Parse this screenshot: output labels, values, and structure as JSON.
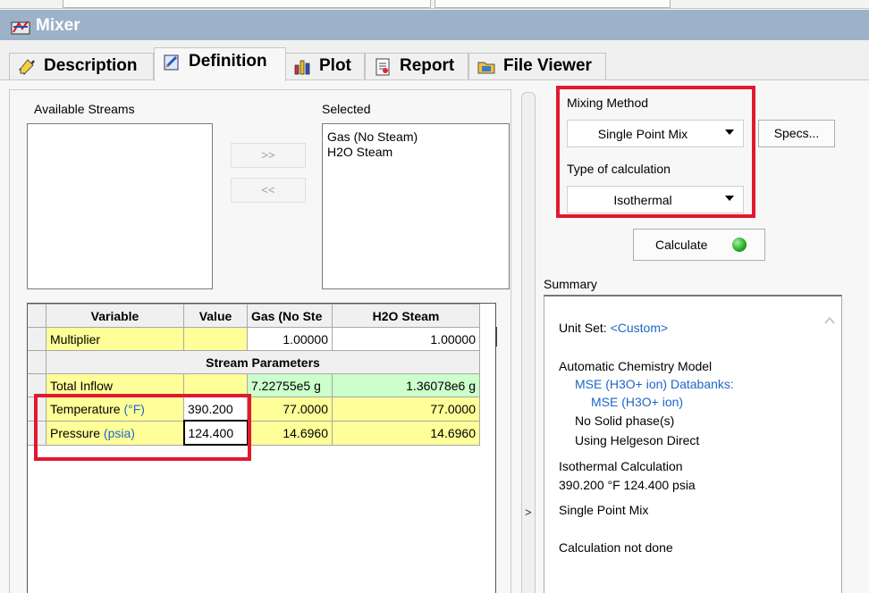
{
  "window": {
    "title": "Mixer"
  },
  "tabs": [
    {
      "label": "Description",
      "icon": "pencil-check-icon",
      "active": false
    },
    {
      "label": "Definition",
      "icon": "definition-edit-icon",
      "active": true
    },
    {
      "label": "Plot",
      "icon": "bar-chart-icon",
      "active": false
    },
    {
      "label": "Report",
      "icon": "report-icon",
      "active": false
    },
    {
      "label": "File Viewer",
      "icon": "file-viewer-icon",
      "active": false
    }
  ],
  "streams": {
    "available_label": "Available Streams",
    "selected_label": "Selected",
    "available_items": [],
    "selected_items": [
      "Gas (No Steam)",
      "H2O Steam"
    ],
    "add_button": ">>",
    "remove_button": "<<"
  },
  "grid": {
    "headers": [
      "Variable",
      "Value",
      "Gas (No Ste",
      "H2O Steam"
    ],
    "multiplier": {
      "label": "Multiplier",
      "value": "",
      "gas": "1.00000",
      "steam": "1.00000"
    },
    "section_label": "Stream Parameters",
    "total_inflow": {
      "label": "Total Inflow",
      "value": "",
      "gas": "7.22755e5 g",
      "steam": "1.36078e6 g"
    },
    "temperature": {
      "label": "Temperature",
      "unit": "(°F)",
      "value": "390.200",
      "gas": "77.0000",
      "steam": "77.0000"
    },
    "pressure": {
      "label": "Pressure",
      "unit": "(psia)",
      "value": "124.400",
      "gas": "14.6960",
      "steam": "14.6960"
    }
  },
  "mixing": {
    "method_label": "Mixing Method",
    "method_value": "Single Point Mix",
    "specs_button": "Specs...",
    "calc_type_label": "Type of calculation",
    "calc_type_value": "Isothermal",
    "calculate_button": "Calculate",
    "status_color": "#22aa22"
  },
  "summary": {
    "label": "Summary",
    "unit_set_label": "Unit Set:",
    "unit_set_value": "<Custom>",
    "chem_model": "Automatic Chemistry Model",
    "databank_line1": "MSE (H3O+ ion) Databanks:",
    "databank_line2": "MSE (H3O+ ion)",
    "solid_phase": "No Solid phase(s)",
    "helgeson": "Using Helgeson Direct",
    "calc_title": "Isothermal Calculation",
    "calc_conditions": "390.200 °F 124.400 psia",
    "mix_type": "Single Point Mix",
    "status": "Calculation not done"
  },
  "colors": {
    "titlebar": "#9db1c8",
    "input_cell": "#ffff99",
    "computed_cell": "#ccffcc",
    "link_blue": "#1e66c8",
    "highlight_red": "#e0192f"
  }
}
